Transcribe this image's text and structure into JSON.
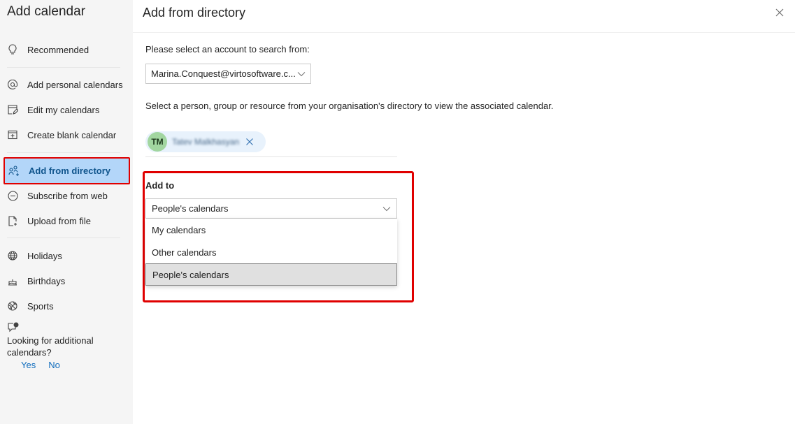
{
  "sidebar": {
    "title": "Add calendar",
    "items": [
      {
        "id": "recommended",
        "label": "Recommended",
        "icon": "lightbulb-icon"
      },
      {
        "id": "add-personal",
        "label": "Add personal calendars",
        "icon": "at-sign-icon"
      },
      {
        "id": "edit-my",
        "label": "Edit my calendars",
        "icon": "edit-calendar-icon"
      },
      {
        "id": "create-blank",
        "label": "Create blank calendar",
        "icon": "calendar-add-icon"
      },
      {
        "id": "add-directory",
        "label": "Add from directory",
        "icon": "people-add-icon",
        "active": true
      },
      {
        "id": "subscribe-web",
        "label": "Subscribe from web",
        "icon": "link-circle-icon"
      },
      {
        "id": "upload-file",
        "label": "Upload from file",
        "icon": "document-add-icon"
      },
      {
        "id": "holidays",
        "label": "Holidays",
        "icon": "globe-icon"
      },
      {
        "id": "birthdays",
        "label": "Birthdays",
        "icon": "cake-icon"
      },
      {
        "id": "sports",
        "label": "Sports",
        "icon": "sports-ball-icon"
      }
    ],
    "feedback": {
      "icon": "chat-alert-icon",
      "question": "Looking for additional calendars?",
      "yes": "Yes",
      "no": "No"
    }
  },
  "main": {
    "title": "Add from directory",
    "close_icon": "close-icon",
    "account_prompt": "Please select an account to search from:",
    "account_value": "Marina.Conquest@virtosoftware.c...",
    "directory_prompt": "Select a person, group or resource from your organisation's directory to view the associated calendar.",
    "selected_person": {
      "initials": "TM",
      "name": "Tatev Malkhasyan"
    },
    "add_to": {
      "label": "Add to",
      "value": "People's calendars",
      "options": [
        "My calendars",
        "Other calendars",
        "People's calendars"
      ],
      "selected_index": 2
    }
  },
  "colors": {
    "accent": "#0f6cbd",
    "active_item_bg": "#b3d6f9",
    "highlight_border": "#e00000",
    "avatar_bg": "#a2d6a0"
  }
}
